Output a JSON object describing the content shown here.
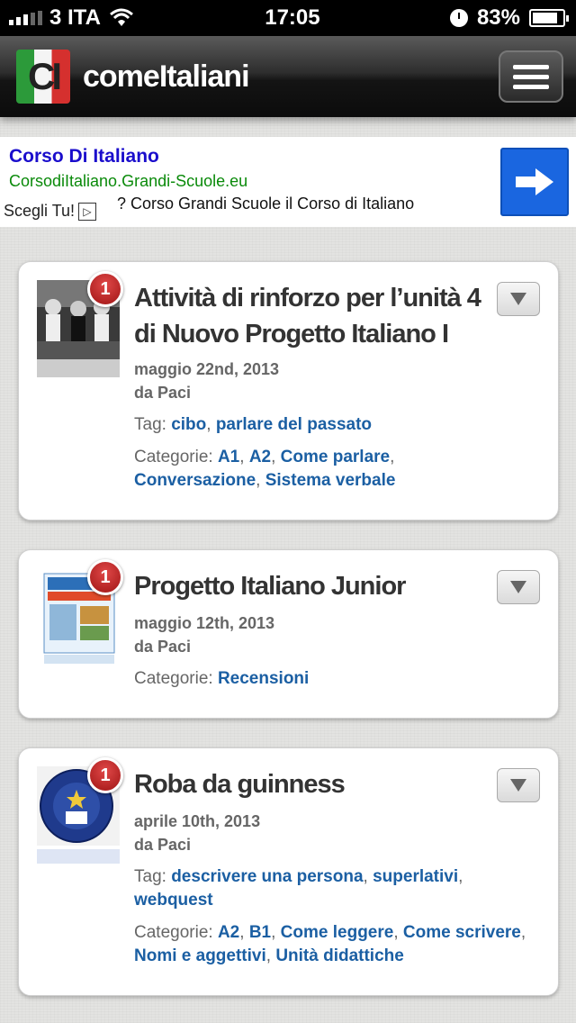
{
  "status_bar": {
    "carrier": "3 ITA",
    "time": "17:05",
    "battery": "83%",
    "battery_level": 0.83
  },
  "header": {
    "logo_text": "CI",
    "site_name": "comeItaliani"
  },
  "ad": {
    "title": "Corso Di Italiano",
    "url": "CorsodiItaliano.Grandi-Scuole.eu",
    "choice_label": "Scegli Tu!",
    "description": "? Corso Grandi Scuole il Corso di Italiano"
  },
  "posts": [
    {
      "badge": "1",
      "title": "Attività di rinforzo per l’unità 4 di Nuovo Progetto Italiano I",
      "date": "maggio 22nd, 2013",
      "author": "da Paci",
      "tag_label": "Tag:",
      "tags": [
        "cibo",
        "parlare del passato"
      ],
      "cat_label": "Categorie:",
      "categories": [
        "A1",
        "A2",
        "Come parlare",
        "Conversazione",
        "Sistema verbale"
      ]
    },
    {
      "badge": "1",
      "title": "Progetto Italiano Junior",
      "date": "maggio 12th, 2013",
      "author": "da Paci",
      "cat_label": "Categorie:",
      "categories": [
        "Recensioni"
      ]
    },
    {
      "badge": "1",
      "title": "Roba da guinness",
      "date": "aprile 10th, 2013",
      "author": "da Paci",
      "tag_label": "Tag:",
      "tags": [
        "descrivere una persona",
        "superlativi",
        "webquest"
      ],
      "cat_label": "Categorie:",
      "categories": [
        "A2",
        "B1",
        "Come leggere",
        "Come scrivere",
        "Nomi e aggettivi",
        "Unità didattiche"
      ]
    }
  ]
}
